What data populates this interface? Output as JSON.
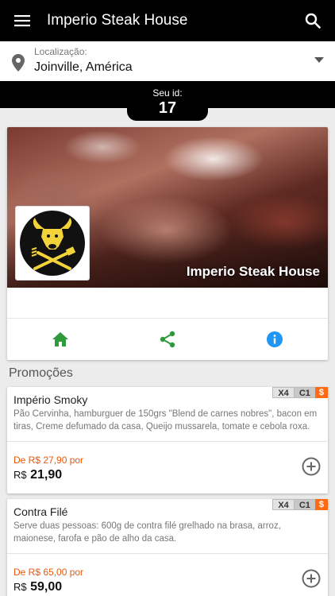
{
  "app_bar": {
    "title": "Imperio Steak House",
    "menu_icon": "menu-icon",
    "search_icon": "search-icon"
  },
  "location": {
    "label": "Localização:",
    "value": "Joinville, América"
  },
  "user_id": {
    "label": "Seu id:",
    "value": "17"
  },
  "store": {
    "name": "Imperio Steak House",
    "actions": [
      "home-icon",
      "share-icon",
      "info-icon"
    ],
    "colors": {
      "home": "#2e9a3b",
      "share": "#2e9a3b",
      "info": "#2196f3"
    }
  },
  "section": {
    "title": "Promoções"
  },
  "promotions": [
    {
      "name": "Império Smoky",
      "description": "Pão Cervinha, hamburguer de 150grs \"Blend de carnes nobres\", bacon em tiras, Creme defumado da casa, Queijo mussarela, tomate e cebola roxa.",
      "old_price": "De R$ 27,90 por",
      "currency": "R$",
      "price": "21,90",
      "badges": [
        "X4",
        "C1",
        "$"
      ]
    },
    {
      "name": "Contra Filé",
      "description": "Serve duas pessoas: 600g de contra filé grelhado na brasa, arroz, maionese, farofa e pão de alho da casa.",
      "old_price": "De R$ 65,00 por",
      "currency": "R$",
      "price": "59,00",
      "badges": [
        "X4",
        "C1",
        "$"
      ]
    }
  ],
  "accent_colors": {
    "old_price": "#e8580c",
    "badge_dollar": "#ff6a13",
    "app_bar": "#000000"
  }
}
